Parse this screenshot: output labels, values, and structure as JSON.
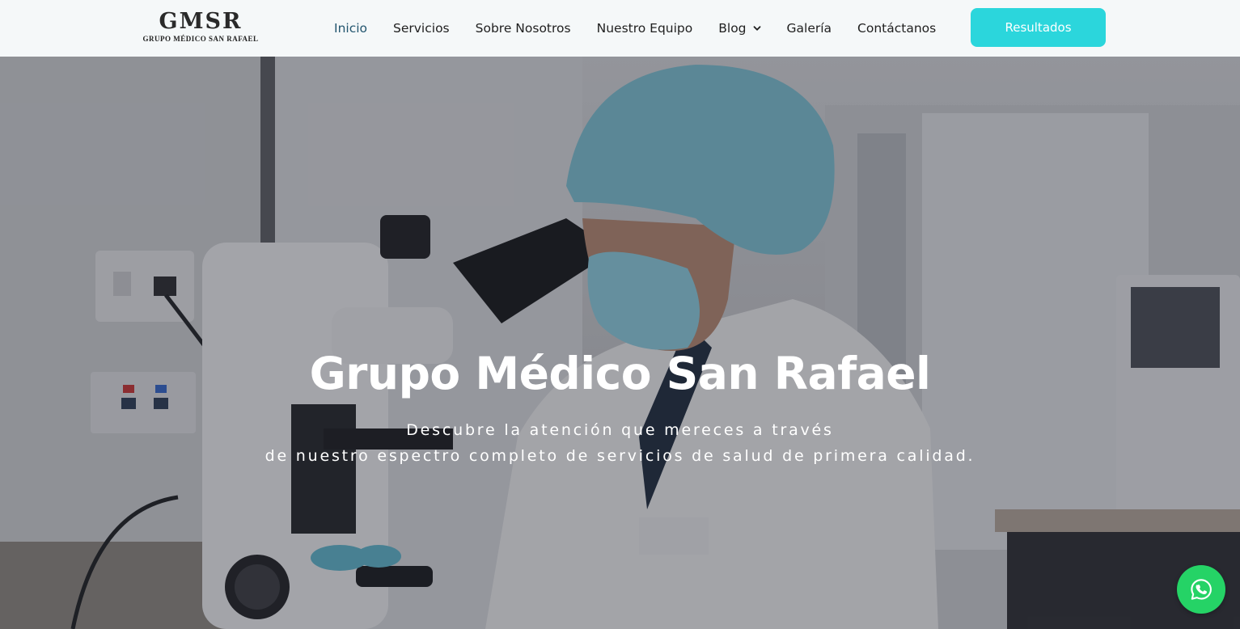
{
  "brand": {
    "logo_mark": "GMSR",
    "logo_sub": "GRUPO MÉDICO SAN RAFAEL"
  },
  "nav": {
    "items": [
      {
        "label": "Inicio",
        "active": true
      },
      {
        "label": "Servicios"
      },
      {
        "label": "Sobre Nosotros"
      },
      {
        "label": "Nuestro Equipo"
      },
      {
        "label": "Blog",
        "has_dropdown": true
      },
      {
        "label": "Galería"
      },
      {
        "label": "Contáctanos"
      }
    ],
    "cta_label": "Resultados"
  },
  "hero": {
    "title": "Grupo Médico San Rafael",
    "subtitle_line1": "Descubre la atención que mereces a través",
    "subtitle_line2": "de nuestro espectro completo de servicios de salud de primera calidad."
  },
  "colors": {
    "accent": "#2bd6dc",
    "nav_active": "#23566f",
    "whatsapp": "#25d366",
    "header_bg": "#f5f8f9"
  },
  "icons": {
    "dropdown": "chevron-down-icon",
    "chat": "whatsapp-icon"
  }
}
